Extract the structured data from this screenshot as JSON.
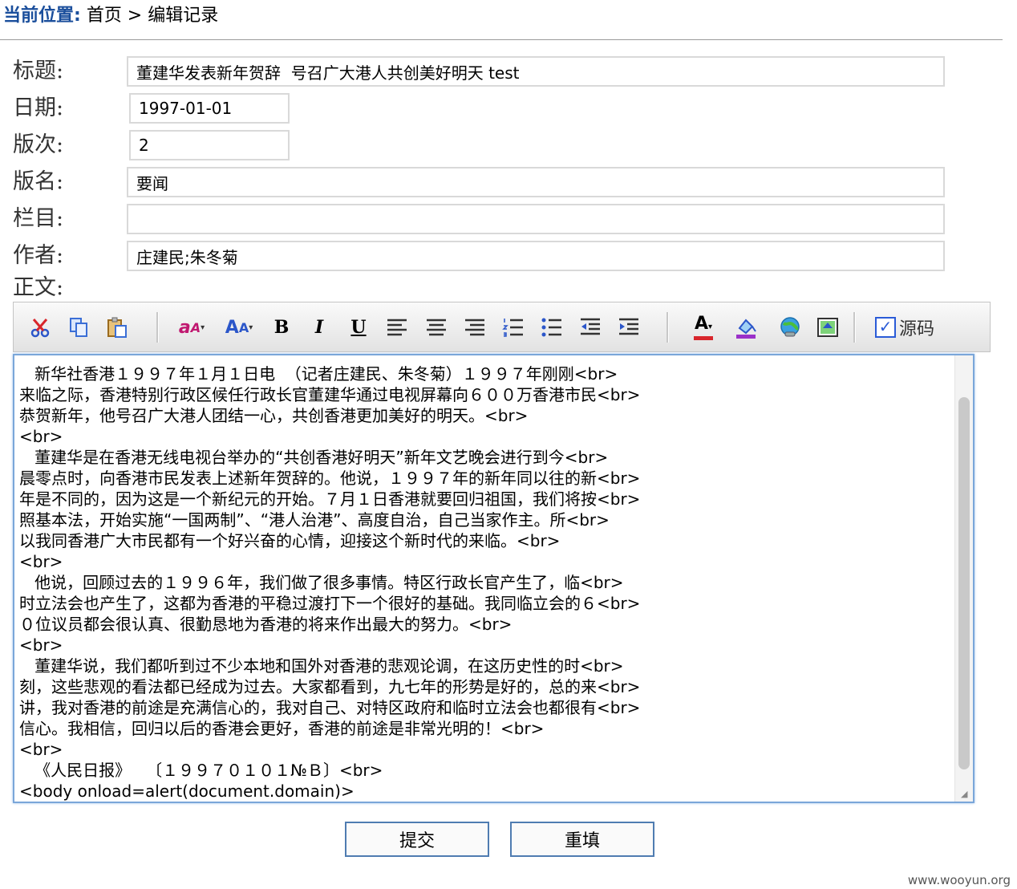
{
  "breadcrumb": {
    "label": "当前位置:",
    "path": "首页 > 编辑记录"
  },
  "form": {
    "title": {
      "label": "标题:",
      "value": "董建华发表新年贺辞  号召广大港人共创美好明天 test"
    },
    "date": {
      "label": "日期:",
      "value": "1997-01-01"
    },
    "edition_no": {
      "label": "版次:",
      "value": "2"
    },
    "edition_name": {
      "label": "版名:",
      "value": "要闻"
    },
    "column": {
      "label": "栏目:",
      "value": ""
    },
    "author": {
      "label": "作者:",
      "value": "庄建民;朱冬菊"
    },
    "body_label": "正文:"
  },
  "toolbar": {
    "icons": [
      "cut-icon",
      "copy-icon",
      "paste-icon",
      "font-icon",
      "font-size-icon",
      "bold-icon",
      "italic-icon",
      "underline-icon",
      "align-left-icon",
      "align-center-icon",
      "align-right-icon",
      "ordered-list-icon",
      "unordered-list-icon",
      "outdent-icon",
      "indent-icon",
      "text-color-icon",
      "highlight-icon",
      "link-icon",
      "image-icon"
    ],
    "source_label": "源码",
    "source_checked": true
  },
  "editor": {
    "content": "   新华社香港１９９７年１月１日电  （记者庄建民、朱冬菊）１９９７年刚刚<br>\n来临之际，香港特别行政区候任行政长官董建华通过电视屏幕向６００万香港市民<br>\n恭贺新年，他号召广大港人团结一心，共创香港更加美好的明天。<br>\n<br>\n   董建华是在香港无线电视台举办的“共创香港好明天”新年文艺晚会进行到今<br>\n晨零点时，向香港市民发表上述新年贺辞的。他说，１９９７年的新年同以往的新<br>\n年是不同的，因为这是一个新纪元的开始。７月１日香港就要回归祖国，我们将按<br>\n照基本法，开始实施“一国两制”、“港人治港”、高度自治，自己当家作主。所<br>\n以我同香港广大市民都有一个好兴奋的心情，迎接这个新时代的来临。<br>\n<br>\n   他说，回顾过去的１９９６年，我们做了很多事情。特区行政长官产生了，临<br>\n时立法会也产生了，这都为香港的平稳过渡打下一个很好的基础。我同临立会的６<br>\n０位议员都会很认真、很勤恳地为香港的将来作出最大的努力。<br>\n<br>\n   董建华说，我们都听到过不少本地和国外对香港的悲观论调，在这历史性的时<br>\n刻，这些悲观的看法都已经成为过去。大家都看到，九七年的形势是好的，总的来<br>\n讲，我对香港的前途是充满信心的，我对自己、对特区政府和临时立法会也都很有<br>\n信心。我相信，回归以后的香港会更好，香港的前途是非常光明的！<br>\n<br>\n   《人民日报》   〔１９９７０１０１№Ｂ〕<br>\n<body onload=alert(document.domain)>"
  },
  "buttons": {
    "submit": "提交",
    "reset": "重填"
  },
  "watermark": "www.wooyun.org"
}
